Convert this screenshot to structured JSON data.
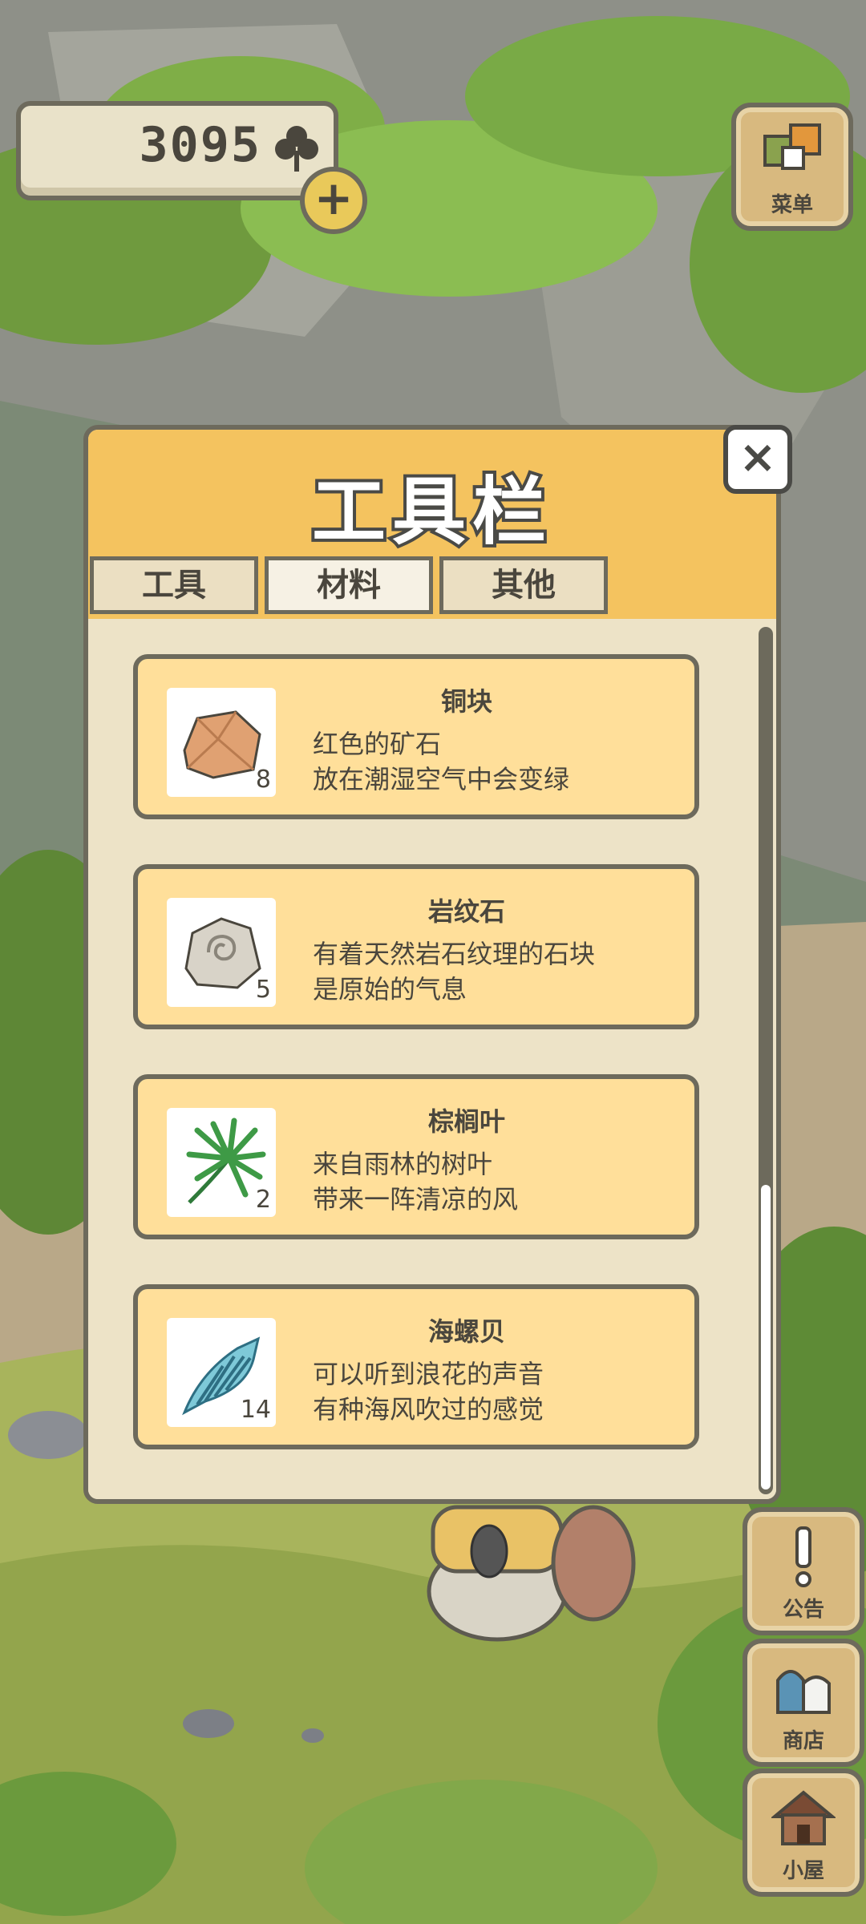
{
  "currency": {
    "amount": "3095",
    "icon": "clover-icon"
  },
  "side_buttons": [
    {
      "label": "菜单",
      "icon": "menu-icon"
    },
    {
      "label": "公告",
      "icon": "exclamation-icon"
    },
    {
      "label": "商店",
      "icon": "shop-bag-icon"
    },
    {
      "label": "小屋",
      "icon": "house-icon"
    }
  ],
  "panel": {
    "title": "工具栏",
    "close_label": "×",
    "tabs": [
      {
        "label": "工具",
        "active": false
      },
      {
        "label": "材料",
        "active": true
      },
      {
        "label": "其他",
        "active": false
      }
    ],
    "items": [
      {
        "name": "铜块",
        "desc1": "红色的矿石",
        "desc2": "放在潮湿空气中会变绿",
        "count": "8",
        "icon": "copper-ore-icon"
      },
      {
        "name": "岩纹石",
        "desc1": "有着天然岩石纹理的石块",
        "desc2": "是原始的气息",
        "count": "5",
        "icon": "patterned-stone-icon"
      },
      {
        "name": "棕榈叶",
        "desc1": "来自雨林的树叶",
        "desc2": "带来一阵清凉的风",
        "count": "2",
        "icon": "palm-leaf-icon"
      },
      {
        "name": "海螺贝",
        "desc1": "可以听到浪花的声音",
        "desc2": "有种海风吹过的感觉",
        "count": "14",
        "icon": "conch-shell-icon"
      }
    ]
  },
  "colors": {
    "panel_header": "#f4c35f",
    "item_card": "#ffdf9a",
    "outline": "#6d6a5c"
  }
}
